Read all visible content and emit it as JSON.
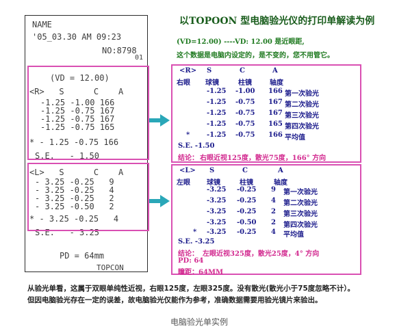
{
  "title": "以TOPOON 型电脑验光仪的打印单解读为例",
  "vd_note_1": "(VD=12.00) ----VD: 12.00 是近眼距,",
  "vd_note_2": "这个数据是电脑内设定的，是不变的，您不用管它。",
  "receipt": {
    "name": "NAME",
    "date": "'05_03.30 AM 09:23",
    "no": "NO:8798",
    "no_sub": "01",
    "vd": "(VD = 12.00)",
    "right": {
      "header": "<R>   S      C    A",
      "rows": [
        "-1.25 -1.00 166",
        "-1.25 -0.75 167",
        "-1.25 -0.75 167",
        "-1.25 -0.75 165"
      ],
      "avg": "* - 1.25 -0.75 166",
      "se": "S.E.   - 1.50"
    },
    "left": {
      "header": "<L>   S      C    A",
      "rows": [
        "- 3.25 -0.25   9",
        "- 3.25 -0.25   4",
        "- 3.25 -0.25   2",
        "- 3.25 -0.50   2"
      ],
      "avg": "* - 3.25 -0.25   4",
      "se": "S.E.   - 3.25"
    },
    "pd": "PD = 64mm",
    "brand": "TOPCON"
  },
  "right_panel": {
    "header": [
      "<R>",
      "S",
      "C",
      "A"
    ],
    "header2": [
      "右眼",
      "球镜",
      "柱镜",
      "轴度"
    ],
    "rows": [
      [
        "-1.25",
        "-1.00",
        "166",
        "第一次验光"
      ],
      [
        "-1.25",
        "-0.75",
        "167",
        "第二次验光"
      ],
      [
        "-1.25",
        "-0.75",
        "167",
        "第三次验光"
      ],
      [
        "-1.25",
        "-0.75",
        "165",
        "第四次验光"
      ],
      [
        "-1.25",
        "-0.75",
        "166",
        "平均值"
      ]
    ],
    "avg_mark": "*",
    "se": "S.E. -1.50",
    "conclusion_label": "结论：",
    "conclusion": "右眼近视125度，散光75度，166° 方向"
  },
  "left_panel": {
    "header": [
      "<L>",
      "S",
      "C",
      "A"
    ],
    "header2": [
      "左眼",
      "球镜",
      "柱镜",
      "轴度"
    ],
    "rows": [
      [
        "-3.25",
        "-0.25",
        "9",
        "第一次验光"
      ],
      [
        "-3.25",
        "-0.25",
        "4",
        "第二次验光"
      ],
      [
        "-3.25",
        "-0.25",
        "2",
        "第三次验光"
      ],
      [
        "-3.25",
        "-0.50",
        "2",
        "第四次验光"
      ],
      [
        "-3.25",
        "-0.25",
        "4",
        "平均值"
      ]
    ],
    "avg_mark": "*",
    "se": "S.E. -3.25",
    "conclusion_label": "结论：",
    "conclusion": "左眼近视325度，散光25度，4° 方向",
    "pd": "PD: 64",
    "distance": "瞳距：64MM"
  },
  "note_1": "从验光单看，这属于双眼单纯性近视，右眼125度，左眼325度。没有散光(散光小于75度忽略不计）。",
  "note_2": "但因电脑验光存在一定的误差，故电脑验光仅能作为参考，准确数据需要用验光镜片来验出。",
  "caption": "电脑验光单实例",
  "colors": {
    "frame": "#d94fb2",
    "arrow": "#2aa7b8",
    "blue": "#1c1c8c",
    "green": "#1f7a20"
  }
}
